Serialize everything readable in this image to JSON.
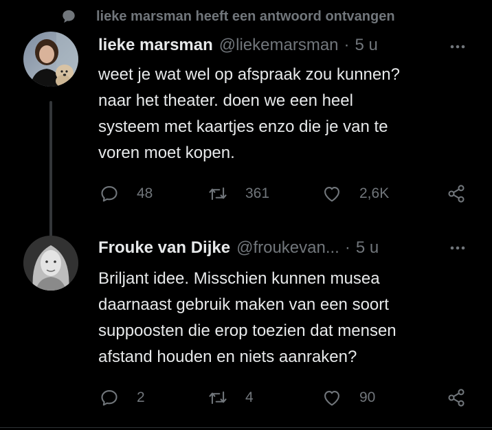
{
  "context": {
    "text": "lieke marsman heeft een antwoord ontvangen",
    "icon": "speech-bubble-icon"
  },
  "tweets": [
    {
      "name": "lieke marsman",
      "handle": "@liekemarsman",
      "separator": "·",
      "time": "5 u",
      "text": "weet je wat wel op afspraak zou kunnen?\nnaar het theater. doen we een heel\nsysteem met kaartjes enzo die je van te\nvoren moet kopen.",
      "replies": "48",
      "retweets": "361",
      "likes": "2,6K"
    },
    {
      "name": "Frouke van Dijke",
      "handle": "@froukevan...",
      "separator": "·",
      "time": "5 u",
      "text": "Briljant idee. Misschien kunnen musea\ndaarnaast gebruik maken van een soort\nsuppoosten die erop toezien dat mensen\nafstand houden en niets aanraken?",
      "replies": "2",
      "retweets": "4",
      "likes": "90"
    }
  ],
  "colors": {
    "background": "#000000",
    "text": "#e7e9ea",
    "secondary": "#71767b",
    "thread_line": "#333639"
  }
}
